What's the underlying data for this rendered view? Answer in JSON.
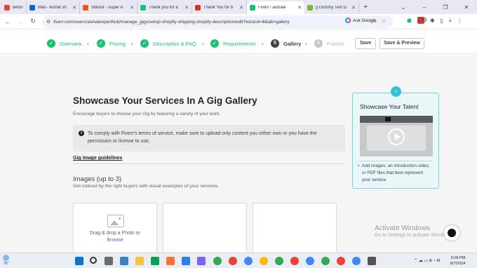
{
  "browser": {
    "tabs": [
      {
        "label": "Before you conti",
        "color": "#ea4335",
        "active": false
      },
      {
        "label": "Mail - Aishat sh",
        "color": "#0a66c2",
        "active": false
      },
      {
        "label": "SBlock - Super A",
        "color": "#f4511e",
        "active": false
      },
      {
        "label": "Thank you for a",
        "color": "#1dbf73",
        "active": false
      },
      {
        "label": "Thank You for b",
        "color": "#d93025",
        "active": false
      },
      {
        "label": "Fiverr / aishate",
        "color": "#1dbf73",
        "active": true
      },
      {
        "label": "|| Dummy Text G",
        "color": "#7cb342",
        "active": false
      }
    ],
    "new_tab": "+",
    "url": "fiverr.com/users/aishatexperthub/manage_gigs/setup-shopify-shipping-shopify-description/edit?wizard=4&tab=gallery",
    "ask_google": "Ask Google",
    "window_controls": [
      "⌄",
      "–",
      "❐",
      "✕"
    ]
  },
  "wizard": {
    "steps": [
      {
        "label": "Overview",
        "status": "done"
      },
      {
        "label": "Pricing",
        "status": "done"
      },
      {
        "label": "Description & FAQ",
        "status": "done"
      },
      {
        "label": "Requirements",
        "status": "done"
      },
      {
        "label": "Gallery",
        "status": "current",
        "number": "5"
      },
      {
        "label": "Publish",
        "status": "pending",
        "number": "6"
      }
    ],
    "save_label": "Save",
    "save_preview_label": "Save & Preview"
  },
  "main": {
    "title": "Showcase Your Services In A Gig Gallery",
    "subtitle": "Encourage buyers to choose your Gig by featuring a variety of your work.",
    "notice": "To comply with Fiverr's terms of service, make sure to upload only content you either own or you have the permission or license to use.",
    "guidelines_link": "Gig image guidelines",
    "images_title": "Images (up to 3)",
    "images_subtitle": "Get noticed by the right buyers with visual examples of your services.",
    "upload_drag": "Drag & drop a Photo or",
    "upload_browse": "Browse"
  },
  "tip": {
    "title": "Showcase Your Talent",
    "bullet": "Add images, an introduction video, or PDF files that best represent your service."
  },
  "watermark": {
    "title": "Activate Windows",
    "subtitle": "Go to Settings to activate Windows."
  },
  "taskbar": {
    "weather_temp": "76°",
    "time": "6:06 PM",
    "date": "8/7/2024"
  }
}
